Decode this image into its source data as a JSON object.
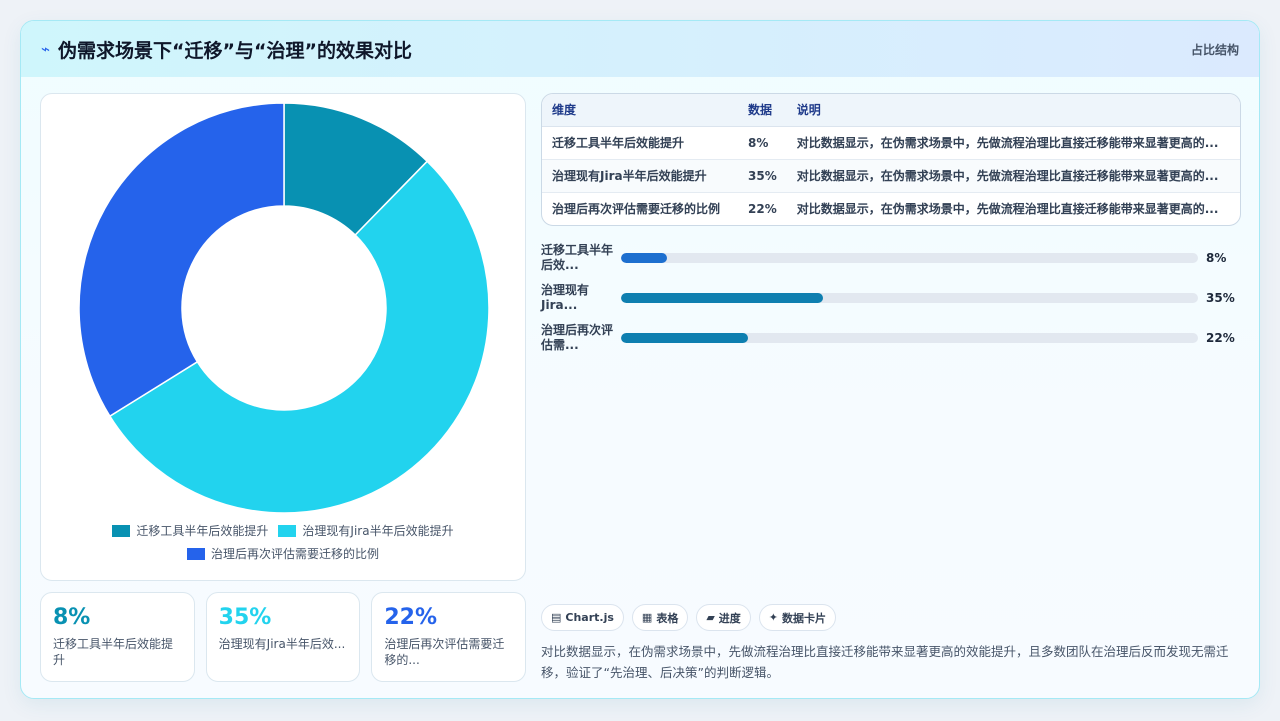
{
  "header": {
    "title": "伪需求场景下“迁移”与“治理”的效果对比",
    "tag": "占比结构"
  },
  "colors": {
    "series": [
      "#0891b2",
      "#22d3ee",
      "#2563eb"
    ],
    "bars": [
      "#1d6fcf",
      "#0e7fb0",
      "#0e7fb0"
    ]
  },
  "chart_data": {
    "type": "pie",
    "variant": "doughnut",
    "categories": [
      "迁移工具半年后效能提升",
      "治理现有Jira半年后效能提升",
      "治理后再次评估需要迁移的比例"
    ],
    "values": [
      8,
      35,
      22
    ],
    "legend_position": "bottom"
  },
  "stats": [
    {
      "value": "8%",
      "label": "迁移工具半年后效能提升"
    },
    {
      "value": "35%",
      "label": "治理现有Jira半年后效..."
    },
    {
      "value": "22%",
      "label": "治理后再次评估需要迁移的..."
    }
  ],
  "table": {
    "headers": [
      "维度",
      "数据",
      "说明"
    ],
    "rows": [
      [
        "迁移工具半年后效能提升",
        "8%",
        "对比数据显示，在伪需求场景中，先做流程治理比直接迁移能带来显著更高的..."
      ],
      [
        "治理现有Jira半年后效能提升",
        "35%",
        "对比数据显示，在伪需求场景中，先做流程治理比直接迁移能带来显著更高的..."
      ],
      [
        "治理后再次评估需要迁移的比例",
        "22%",
        "对比数据显示，在伪需求场景中，先做流程治理比直接迁移能带来显著更高的..."
      ]
    ]
  },
  "bars": [
    {
      "label": "迁移工具半年后效...",
      "value": 8,
      "display": "8%"
    },
    {
      "label": "治理现有Jira...",
      "value": 35,
      "display": "35%"
    },
    {
      "label": "治理后再次评估需...",
      "value": 22,
      "display": "22%"
    }
  ],
  "chips": [
    {
      "icon": "▤",
      "label": "Chart.js"
    },
    {
      "icon": "▦",
      "label": "表格"
    },
    {
      "icon": "▰",
      "label": "进度"
    },
    {
      "icon": "✦",
      "label": "数据卡片"
    }
  ],
  "description": "对比数据显示，在伪需求场景中，先做流程治理比直接迁移能带来显著更高的效能提升，且多数团队在治理后反而发现无需迁移，验证了“先治理、后决策”的判断逻辑。"
}
